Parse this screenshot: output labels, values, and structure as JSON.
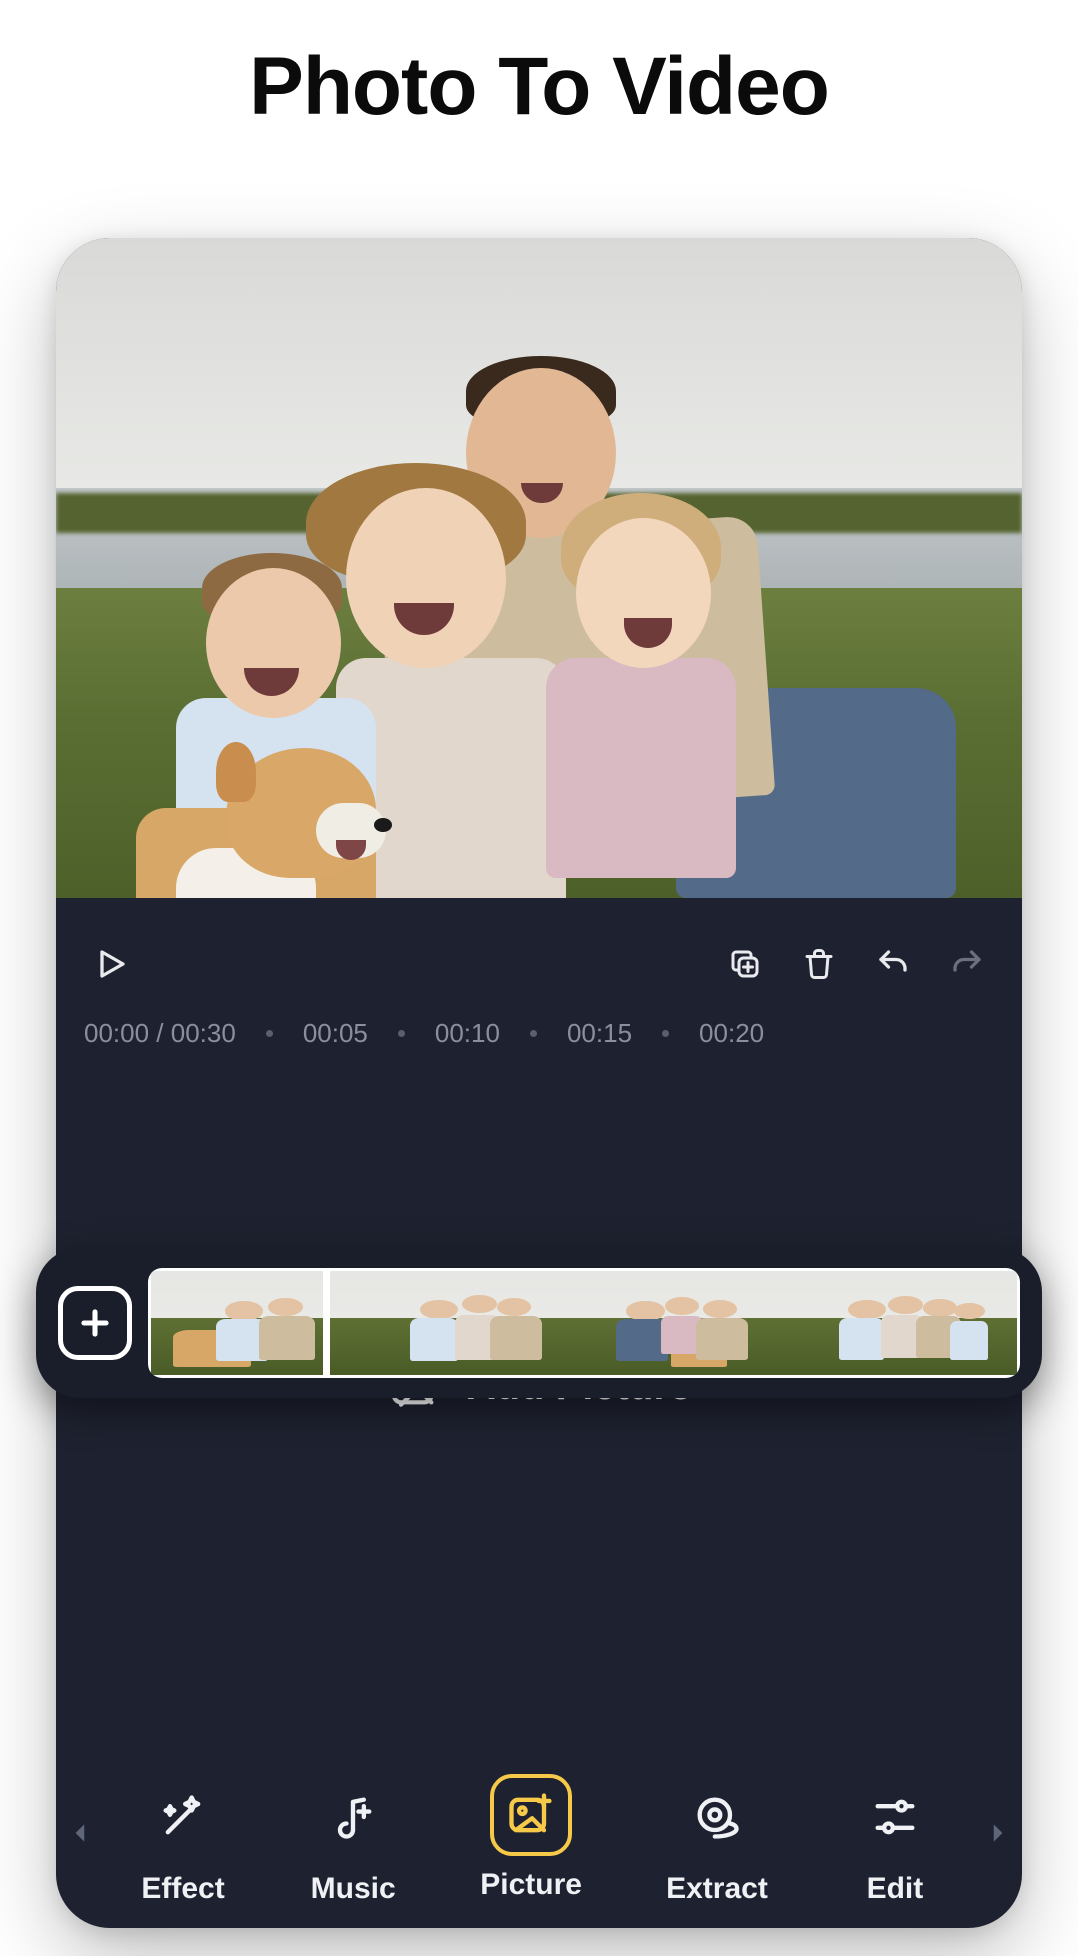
{
  "hero_title": "Photo To Video",
  "controls": {
    "play": "Play",
    "copy": "Copy",
    "delete": "Delete",
    "undo": "Undo",
    "redo": "Redo"
  },
  "ruler": {
    "position": "00:00 / 00:30",
    "ticks": [
      "00:05",
      "00:10",
      "00:15",
      "00:20"
    ]
  },
  "timeline": {
    "add_clip": "Add clip",
    "clip_count": 4
  },
  "add_picture_label": "Add Picture",
  "toolbar": {
    "items": [
      {
        "key": "effect",
        "label": "Effect",
        "active": false
      },
      {
        "key": "music",
        "label": "Music",
        "active": false
      },
      {
        "key": "picture",
        "label": "Picture",
        "active": true
      },
      {
        "key": "extract",
        "label": "Extract",
        "active": false
      },
      {
        "key": "edit",
        "label": "Edit",
        "active": false
      }
    ]
  }
}
